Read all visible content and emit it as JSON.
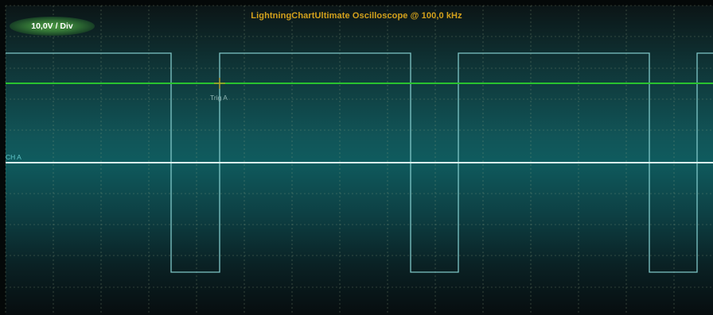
{
  "title": "LightningChartUltimate Oscilloscope @ 100,0 kHz",
  "scale_label": "10,0V / Div",
  "channel_label": "CH A",
  "trigger_label": "Trig A",
  "colors": {
    "title": "#d4a11c",
    "square_wave": "#7fc7c8",
    "channel_line": "#d8f2ee",
    "trigger_line": "#29c22f",
    "trigger_marker": "#c79a1f",
    "grid": "#95a886"
  }
}
